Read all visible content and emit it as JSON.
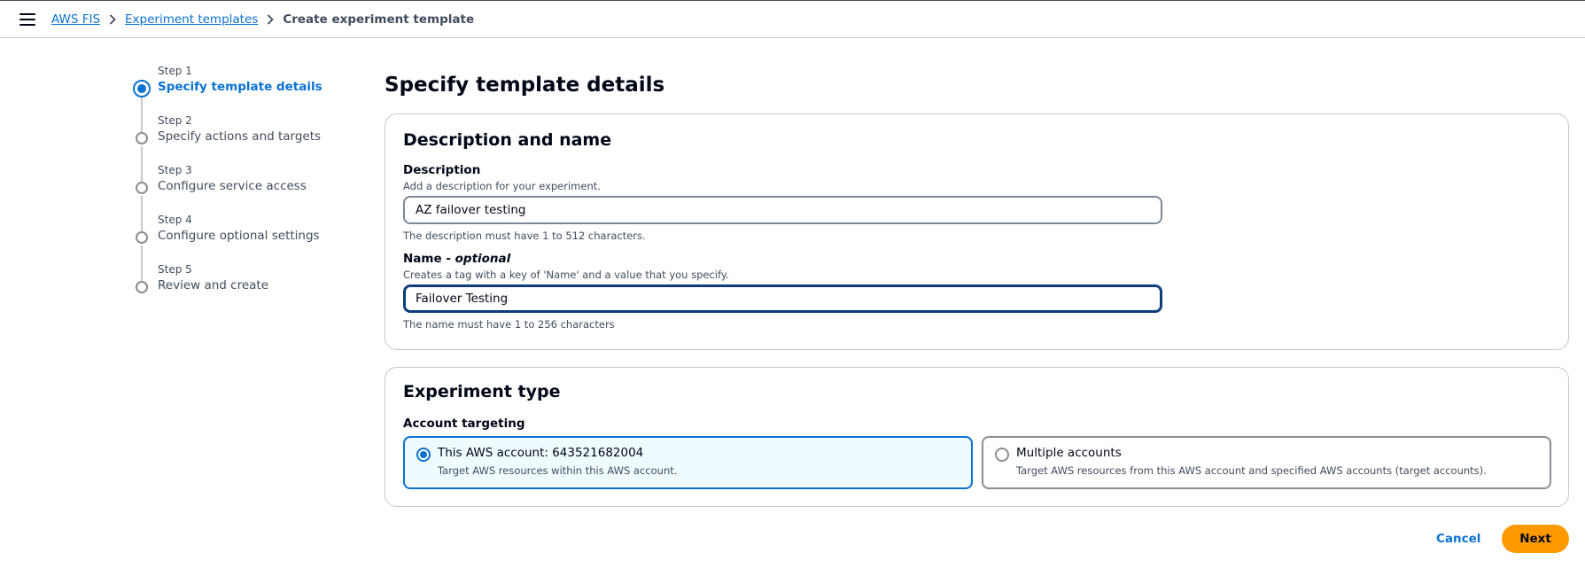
{
  "breadcrumbs": {
    "root": "AWS FIS",
    "parent": "Experiment templates",
    "current": "Create experiment template"
  },
  "wizard": {
    "steps": [
      {
        "num": "Step 1",
        "title": "Specify template details",
        "active": true
      },
      {
        "num": "Step 2",
        "title": "Specify actions and targets",
        "active": false
      },
      {
        "num": "Step 3",
        "title": "Configure service access",
        "active": false
      },
      {
        "num": "Step 4",
        "title": "Configure optional settings",
        "active": false
      },
      {
        "num": "Step 5",
        "title": "Review and create",
        "active": false
      }
    ]
  },
  "page": {
    "title": "Specify template details"
  },
  "description_panel": {
    "heading": "Description and name",
    "description": {
      "label": "Description",
      "hint": "Add a description for your experiment.",
      "value": "AZ failover testing",
      "constraint": "The description must have 1 to 512 characters."
    },
    "name": {
      "label": "Name - ",
      "label_optional": "optional",
      "hint": "Creates a tag with a key of 'Name' and a value that you specify.",
      "value": "Failover Testing",
      "constraint": "The name must have 1 to 256 characters"
    }
  },
  "experiment_type": {
    "heading": "Experiment type",
    "targeting_label": "Account targeting",
    "options": [
      {
        "title": "This AWS account: 643521682004",
        "desc": "Target AWS resources within this AWS account.",
        "selected": true
      },
      {
        "title": "Multiple accounts",
        "desc": "Target AWS resources from this AWS account and specified AWS accounts (target accounts).",
        "selected": false
      }
    ]
  },
  "footer": {
    "cancel_label": "Cancel",
    "next_label": "Next"
  },
  "colors": {
    "accent": "#0972d3",
    "primary_button": "#ff9900",
    "text": "#000716"
  }
}
